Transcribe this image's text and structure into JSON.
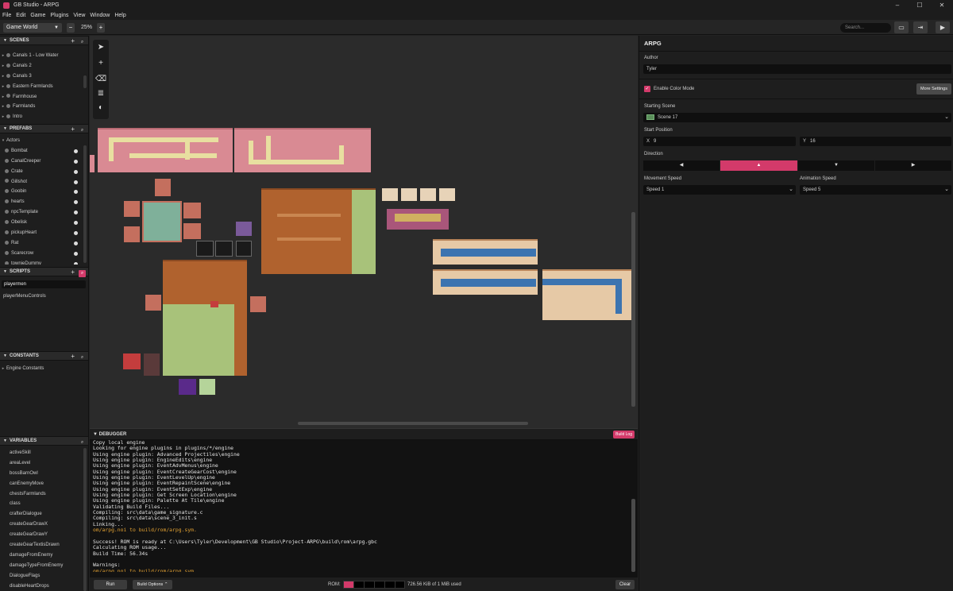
{
  "window": {
    "title": "GB Studio - ARPG"
  },
  "menu": [
    "File",
    "Edit",
    "Game",
    "Plugins",
    "View",
    "Window",
    "Help"
  ],
  "toolbar": {
    "world_select": "Game World",
    "zoom": "25%",
    "search_placeholder": "Search..."
  },
  "sidebar": {
    "scenes": {
      "title": "SCENES",
      "items": [
        "Canals 1 - Low Water",
        "Canals 2",
        "Canals 3",
        "Eastern Farmlands",
        "Farmhouse",
        "Farmlands",
        "Intro"
      ]
    },
    "prefabs": {
      "title": "PREFABS",
      "folder": "Actors",
      "items": [
        "Bombat",
        "CanalCreeper",
        "Crate",
        "Gillshot",
        "Goobin",
        "hearts",
        "npcTemplate",
        "Obelisk",
        "pickupHeart",
        "Rat",
        "Scarecrow",
        "townieDummy"
      ]
    },
    "scripts": {
      "title": "SCRIPTS",
      "search_value": "playermen",
      "items": [
        "playerMenuControls"
      ]
    },
    "constants": {
      "title": "CONSTANTS",
      "items": [
        "Engine Constants"
      ]
    },
    "variables": {
      "title": "VARIABLES",
      "items": [
        "activeSkill",
        "areaLevel",
        "bossBarnOwl",
        "canEnemyMove",
        "chestsFarmlands",
        "class",
        "crafterDialogue",
        "createGearDrawX",
        "createGearDrawY",
        "createGearTextisDrawn",
        "damageFromEnemy",
        "damageTypeFromEnemy",
        "DialogueFlags",
        "disableHeartDrops"
      ]
    }
  },
  "debugger": {
    "title": "DEBUGGER",
    "build_log_label": "Build Log",
    "log": [
      "Copy local engine",
      "Looking for engine plugins in plugins/*/engine",
      "Using engine plugin: Advanced Projectiles\\engine",
      "Using engine plugin: EngineEdits\\engine",
      "Using engine plugin: EventAdvMenus\\engine",
      "Using engine plugin: EventCreateGearCost\\engine",
      "Using engine plugin: EventLevelUp\\engine",
      "Using engine plugin: EventRepaintScene\\engine",
      "Using engine plugin: EventSetExp\\engine",
      "Using engine plugin: Get Screen Location\\engine",
      "Using engine plugin: Palette At Tile\\engine",
      "Validating Build Files...",
      "Compiling: src\\data\\game_signature.c",
      "Compiling: src\\data\\scene_3_init.s",
      "Linking...",
      "om/arpg.noi to build/rom/arpg.sym.",
      "",
      "Success! ROM is ready at C:\\Users\\Tyler\\Development\\GB Studio\\Project-ARPG\\build\\rom\\arpg.gbc",
      "Calculating ROM usage...",
      "Build Time: 56.34s",
      "",
      "Warnings:",
      "om/arpg.noi to build/rom/arpg.sym."
    ],
    "orange_lines": [
      15,
      22
    ],
    "run_label": "Run",
    "build_options_label": "Build Options",
    "rom_label": "ROM:",
    "rom_used_text": "726.56 KiB of 1 MiB used",
    "clear_label": "Clear"
  },
  "panel": {
    "title": "ARPG",
    "author_label": "Author",
    "author_value": "Tyler",
    "color_mode_label": "Enable Color Mode",
    "more_settings_label": "More Settings",
    "starting_scene_label": "Starting Scene",
    "starting_scene_value": "Scene 17",
    "start_position_label": "Start Position",
    "x_label": "X",
    "x_value": "9",
    "y_label": "Y",
    "y_value": "16",
    "direction_label": "Direction",
    "directions": [
      "◀",
      "▲",
      "▼",
      "▶"
    ],
    "active_direction": 1,
    "movement_speed_label": "Movement Speed",
    "movement_speed_value": "Speed 1",
    "animation_speed_label": "Animation Speed",
    "animation_speed_value": "Speed 5"
  },
  "colors": {
    "accent": "#d33a6a",
    "log_warning": "#e3a233"
  }
}
